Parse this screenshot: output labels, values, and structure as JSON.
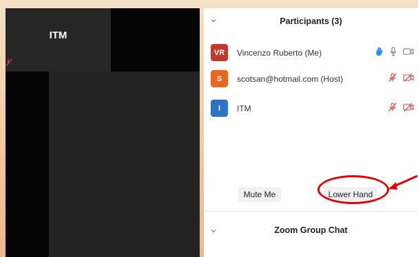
{
  "video": {
    "top_tile_name": "ITM"
  },
  "participants_panel": {
    "title": "Participants (3)",
    "participants": [
      {
        "initials": "VR",
        "name": "Vincenzo Ruberto (Me)",
        "avatar_color": "#c0392b",
        "hand_raised": true,
        "mic_muted": false,
        "video_off": false
      },
      {
        "initials": "S",
        "name": "scotsan@hotmail.com (Host)",
        "avatar_color": "#e8671c",
        "hand_raised": false,
        "mic_muted": true,
        "video_off": true
      },
      {
        "initials": "I",
        "name": "ITM",
        "avatar_color": "#2d73c4",
        "hand_raised": false,
        "mic_muted": true,
        "video_off": true
      }
    ],
    "buttons": {
      "mute_me": "Mute Me",
      "lower_hand": "Lower Hand"
    }
  },
  "chat_panel": {
    "title": "Zoom Group Chat"
  },
  "colors": {
    "accent_blue": "#2d8cff",
    "muted_red": "#e0443e",
    "annotation_red": "#e00000"
  },
  "icons": [
    "chevron-down-icon",
    "raised-hand-icon",
    "microphone-icon",
    "video-camera-icon",
    "muted-microphone-icon",
    "video-off-icon",
    "arrow-annotation"
  ]
}
